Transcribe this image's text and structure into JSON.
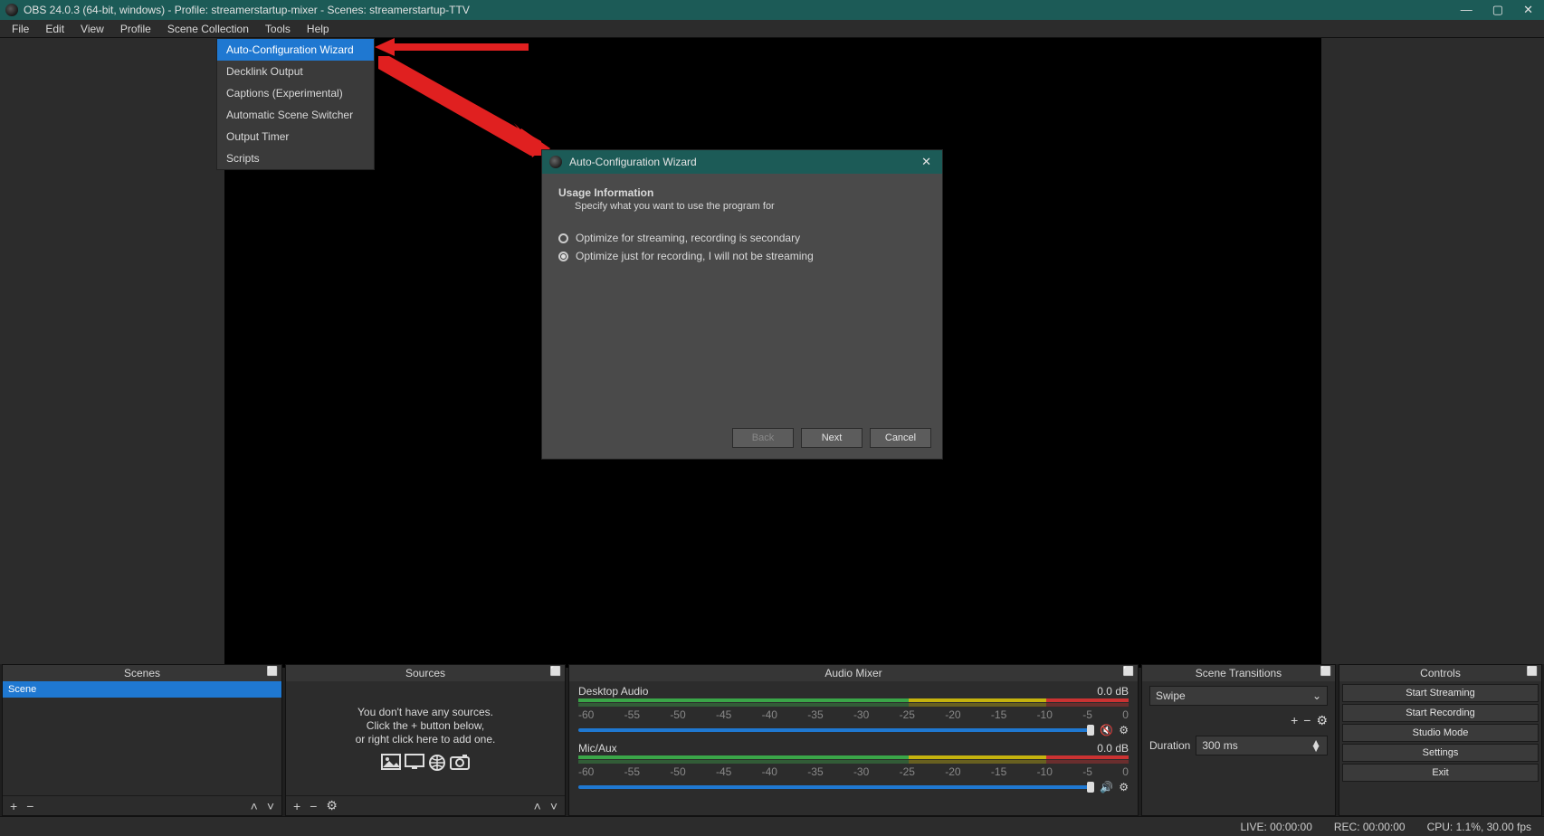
{
  "titlebar": {
    "text": "OBS 24.0.3 (64-bit, windows) - Profile: streamerstartup-mixer - Scenes: streamerstartup-TTV"
  },
  "menubar": [
    "File",
    "Edit",
    "View",
    "Profile",
    "Scene Collection",
    "Tools",
    "Help"
  ],
  "tools_dropdown": [
    "Auto-Configuration Wizard",
    "Decklink Output",
    "Captions (Experimental)",
    "Automatic Scene Switcher",
    "Output Timer",
    "Scripts"
  ],
  "wizard": {
    "title": "Auto-Configuration Wizard",
    "heading": "Usage Information",
    "sub": "Specify what you want to use the program for",
    "options": [
      "Optimize for streaming, recording is secondary",
      "Optimize just for recording, I will not be streaming"
    ],
    "back": "Back",
    "next": "Next",
    "cancel": "Cancel"
  },
  "docks": {
    "scenes": {
      "title": "Scenes",
      "items": [
        "Scene"
      ]
    },
    "sources": {
      "title": "Sources",
      "empty_lines": [
        "You don't have any sources.",
        "Click the + button below,",
        "or right click here to add one."
      ]
    },
    "mixer": {
      "title": "Audio Mixer",
      "tracks": [
        {
          "name": "Desktop Audio",
          "db": "0.0 dB"
        },
        {
          "name": "Mic/Aux",
          "db": "0.0 dB"
        }
      ],
      "tick_labels": [
        "-60",
        "-55",
        "-50",
        "-45",
        "-40",
        "-35",
        "-30",
        "-25",
        "-20",
        "-15",
        "-10",
        "-5",
        "0"
      ]
    },
    "transitions": {
      "title": "Scene Transitions",
      "selected": "Swipe",
      "duration_label": "Duration",
      "duration_value": "300 ms"
    },
    "controls": {
      "title": "Controls",
      "buttons": [
        "Start Streaming",
        "Start Recording",
        "Studio Mode",
        "Settings",
        "Exit"
      ]
    }
  },
  "statusbar": {
    "live": "LIVE: 00:00:00",
    "rec": "REC: 00:00:00",
    "cpu": "CPU: 1.1%, 30.00 fps"
  }
}
